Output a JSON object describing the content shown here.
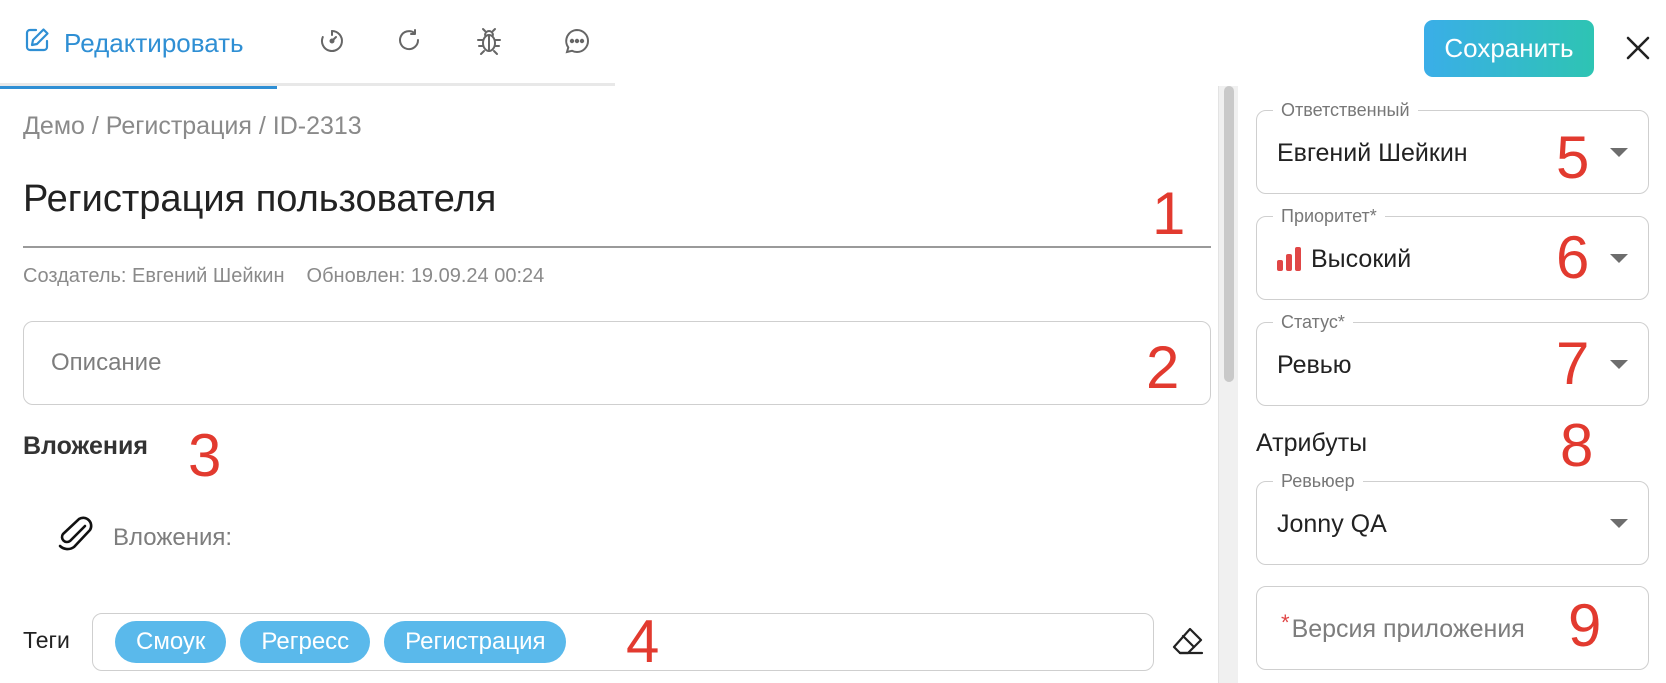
{
  "tabs": {
    "edit_label": "Редактировать",
    "icons": [
      "edit-icon",
      "timer-icon",
      "refresh-icon",
      "bug-icon",
      "comment-icon"
    ]
  },
  "header": {
    "save_label": "Сохранить",
    "close_icon": "close-icon"
  },
  "breadcrumb": "Демо / Регистрация / ID-2313",
  "task": {
    "title": "Регистрация пользователя",
    "creator": "Создатель: Евгений Шейкин",
    "updated": "Обновлен: 19.09.24 00:24"
  },
  "description": {
    "placeholder": "Описание"
  },
  "attachments": {
    "heading": "Вложения",
    "label": "Вложения:",
    "icon": "paperclip-icon"
  },
  "tags": {
    "label": "Теги",
    "items": [
      "Смоук",
      "Регресс",
      "Регистрация"
    ],
    "clear_icon": "eraser-icon",
    "chip_color": "#5ab9eb"
  },
  "sidebar": {
    "assignee": {
      "legend": "Ответственный",
      "value": "Евгений Шейкин"
    },
    "priority": {
      "legend": "Приоритет*",
      "value": "Высокий",
      "color": "#e04646"
    },
    "status": {
      "legend": "Статус*",
      "value": "Ревью"
    },
    "attributes_heading": "Атрибуты",
    "reviewer": {
      "legend": "Ревьюер",
      "value": "Jonny QA"
    },
    "app_version": {
      "required_mark": "*",
      "placeholder": "Версия приложения"
    }
  },
  "annotations": [
    "1",
    "2",
    "3",
    "4",
    "5",
    "6",
    "7",
    "8",
    "9"
  ],
  "colors": {
    "accent": "#2f8fd4",
    "save_gradient": [
      "#3aaee8",
      "#2ec4b3"
    ],
    "annotation": "#e23a2f"
  }
}
